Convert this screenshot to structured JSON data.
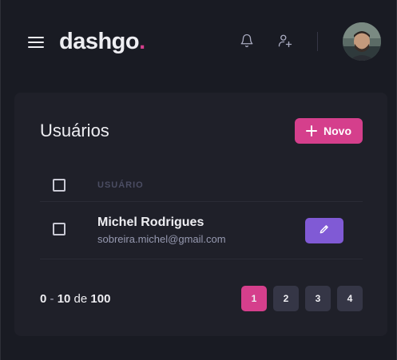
{
  "header": {
    "logo_text": "dashgo",
    "logo_dot": ".",
    "colors": {
      "accent": "#d53f8c",
      "background": "#191b23"
    }
  },
  "users_card": {
    "title": "Usuários",
    "new_button_label": "Novo",
    "table": {
      "column_header": "USUÁRIO",
      "rows": [
        {
          "name": "Michel Rodrigues",
          "email": "sobreira.michel@gmail.com"
        }
      ]
    },
    "pagination": {
      "range_start": "0",
      "range_sep": "-",
      "range_end": "10",
      "of_label": "de",
      "total": "100",
      "pages": [
        "1",
        "2",
        "3",
        "4"
      ],
      "current_page": "1"
    }
  },
  "icons": {
    "menu": "menu-icon",
    "notifications": "bell-icon",
    "add_user": "user-plus-icon",
    "add": "plus-icon",
    "edit": "pencil-icon"
  }
}
